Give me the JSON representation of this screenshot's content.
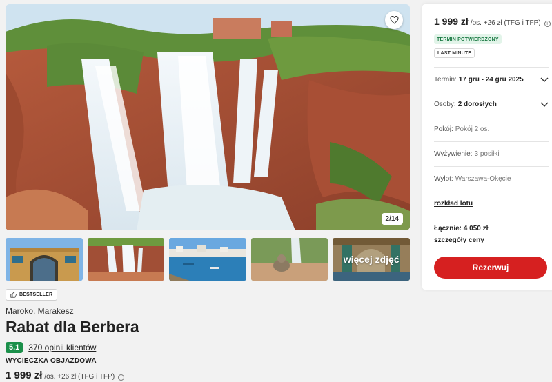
{
  "gallery": {
    "counter": "2/14",
    "more_photos_label": "więcej zdjęć",
    "thumbnails": [
      "thumb-gate",
      "thumb-waterfall",
      "thumb-harbor",
      "thumb-monkey",
      "thumb-interior"
    ]
  },
  "offer": {
    "badge": "BESTSELLER",
    "location": "Maroko, Marakesz",
    "title": "Rabat dla Berbera",
    "rating": "5.1",
    "reviews": "370 opinii klientów",
    "tour_type": "WYCIECZKA OBJAZDOWA",
    "price": "1 999 zł",
    "price_suffix": "/os. +26 zł (TFG i TFP)"
  },
  "panel": {
    "price": "1 999 zł",
    "price_suffix": "/os. +26 zł (TFG i TFP)",
    "tag_confirmed": "TERMIN POTWIERDZONY",
    "tag_lastminute": "LAST MINUTE",
    "term_label": "Termin:",
    "term_value": "17 gru - 24 gru 2025",
    "persons_label": "Osoby:",
    "persons_value": "2 dorosłych",
    "room_label": "Pokój:",
    "room_value": "Pokój 2 os.",
    "board_label": "Wyżywienie:",
    "board_value": "3 posiłki",
    "departure_label": "Wylot:",
    "departure_value": "Warszawa-Okęcie",
    "flight_schedule": "rozkład lotu",
    "total_label": "Łącznie:",
    "total_value": "4 050 zł",
    "price_details": "szczegóły ceny",
    "book_label": "Rezerwuj"
  },
  "colors": {
    "accent_red": "#d62020",
    "rating_green": "#1a8f4a",
    "confirmed_bg": "#e2f4e9",
    "confirmed_text": "#1c7a45"
  },
  "icons": {
    "favorite": "heart-icon",
    "badge": "thumbs-up-icon",
    "info": "info-icon",
    "dropdown": "chevron-down-icon"
  }
}
